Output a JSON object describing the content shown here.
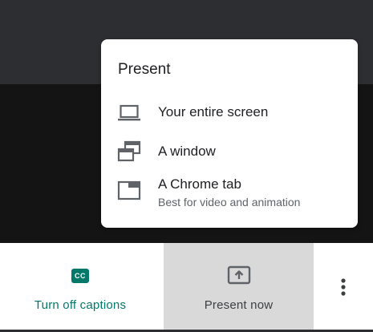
{
  "controls": {
    "captions_label": "Turn off captions",
    "captions_icon_text": "CC",
    "present_label": "Present now"
  },
  "popup": {
    "title": "Present",
    "items": [
      {
        "label": "Your entire screen",
        "icon": "laptop-icon"
      },
      {
        "label": "A window",
        "icon": "window-icon"
      },
      {
        "label": "A Chrome tab",
        "subtitle": "Best for video and animation",
        "icon": "tab-icon"
      }
    ]
  },
  "colors": {
    "accent": "#00796b",
    "active_bg": "#d9d9d9",
    "text": "#202124",
    "muted": "#5f6368"
  }
}
